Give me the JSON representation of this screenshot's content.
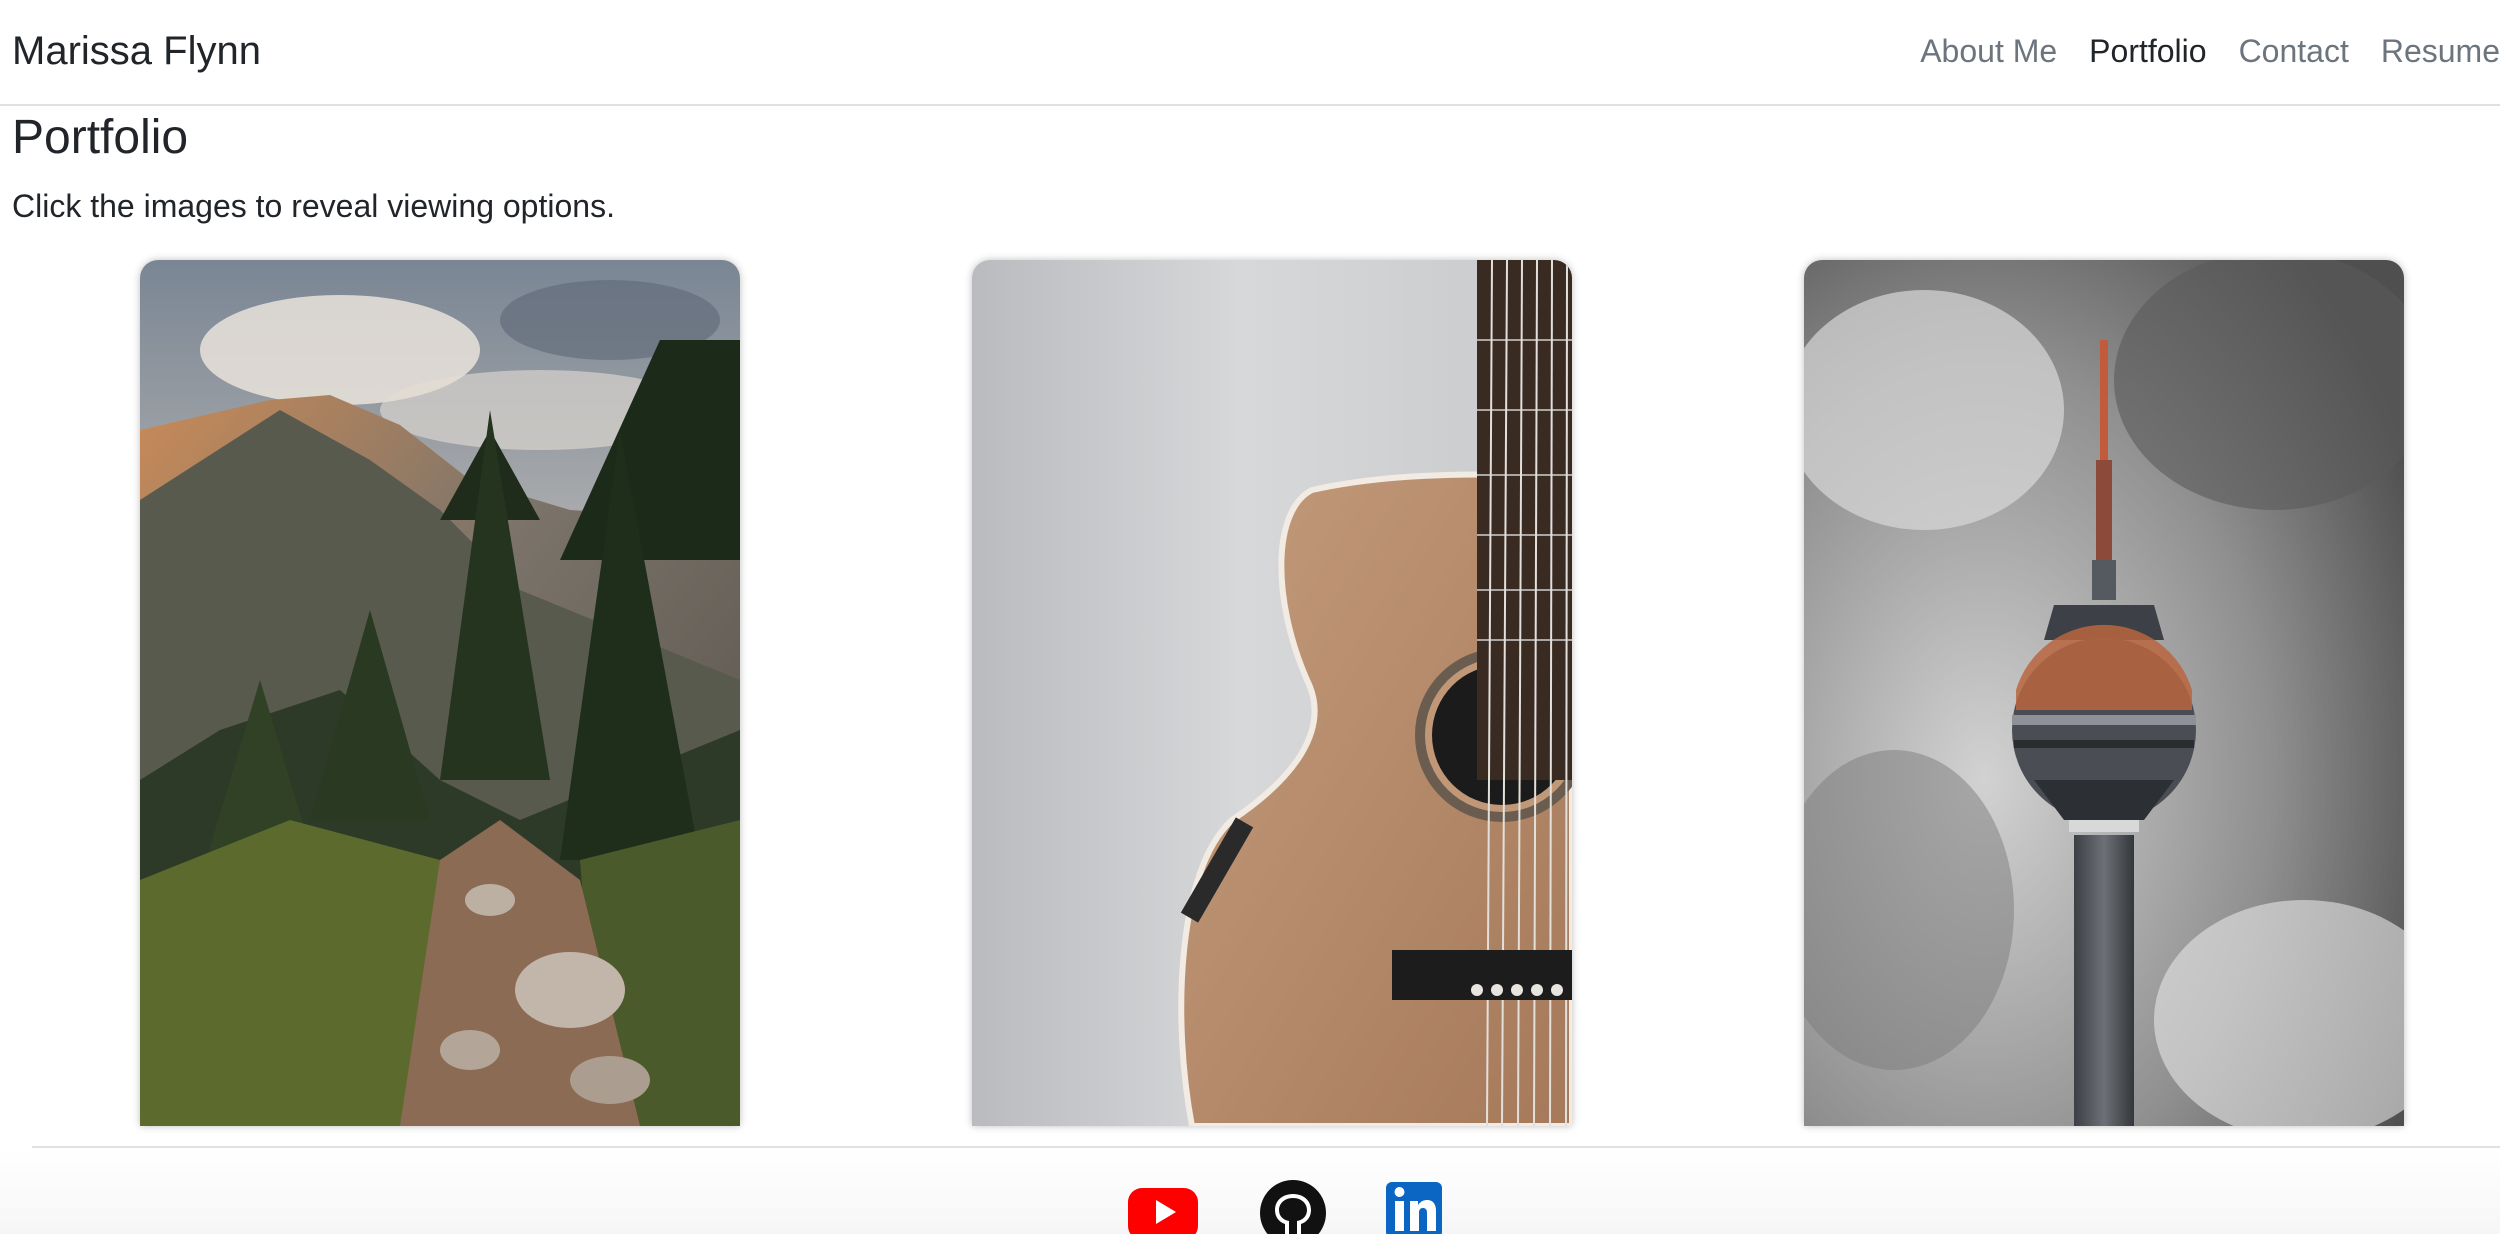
{
  "navbar": {
    "brand": "Marissa Flynn",
    "links": [
      {
        "label": "About Me",
        "active": false
      },
      {
        "label": "Portfolio",
        "active": true
      },
      {
        "label": "Contact",
        "active": false
      },
      {
        "label": "Resume",
        "active": false
      }
    ]
  },
  "page": {
    "title": "Portfolio",
    "subtitle": "Click the images to reveal viewing options."
  },
  "gallery": {
    "images": [
      {
        "subject": "mountain-trail"
      },
      {
        "subject": "acoustic-guitar"
      },
      {
        "subject": "tv-tower"
      }
    ]
  },
  "footer": {
    "social": [
      {
        "icon": "youtube-icon",
        "color": "#ff0000"
      },
      {
        "icon": "github-icon",
        "color": "#111111"
      },
      {
        "icon": "linkedin-icon",
        "color": "#0a66c2"
      }
    ]
  }
}
